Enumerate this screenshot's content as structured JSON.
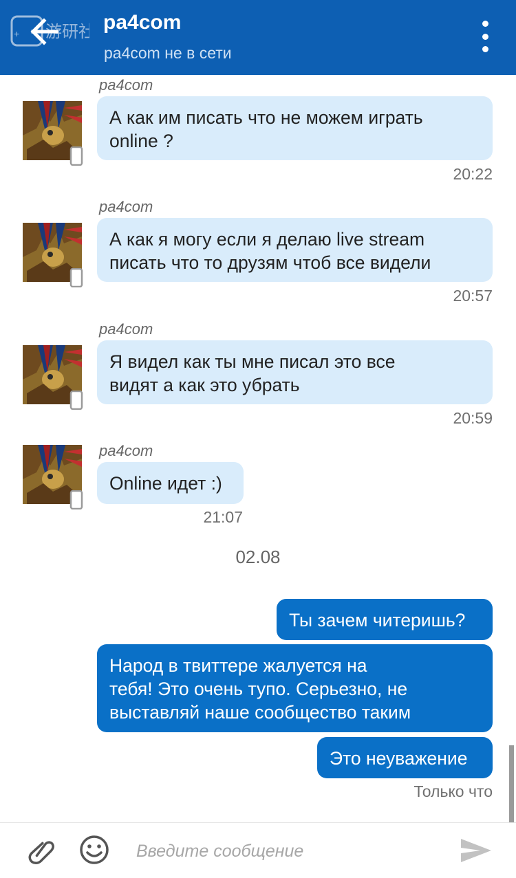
{
  "header": {
    "title": "pa4com",
    "status": "pa4com не в сети",
    "back_icon": "arrow-left-icon",
    "menu_icon": "more-vertical-icon",
    "watermark_text": "游研社",
    "color": "#0d5fb3"
  },
  "messages_in": [
    {
      "sender": "pa4com",
      "lines": [
        "А как им писать что не можем играть",
        "online ?"
      ],
      "time": "20:22"
    },
    {
      "sender": "pa4com",
      "lines": [
        "А как я могу если я делаю live stream",
        "писать что то друзям чтоб все видели"
      ],
      "time": "20:57"
    },
    {
      "sender": "pa4com",
      "lines": [
        "Я видел как ты мне писал это все",
        "видят а как это убрать"
      ],
      "time": "20:59"
    },
    {
      "sender": "pa4com",
      "lines": [
        "Online идет :)"
      ],
      "time": "21:07"
    }
  ],
  "date_separator": "02.08",
  "messages_out": [
    {
      "lines": [
        "Ты зачем читеришь?"
      ]
    },
    {
      "lines": [
        "Народ в твиттере жалуется на",
        "тебя! Это очень тупо. Серьезно,  не",
        "выставляй наше сообщество таким"
      ]
    },
    {
      "lines": [
        "Это неуважение"
      ]
    }
  ],
  "out_time": "Только что",
  "composer": {
    "placeholder": "Введите сообщение",
    "attach_icon": "paperclip-icon",
    "emoji_icon": "smiley-icon",
    "send_icon": "send-icon"
  },
  "colors": {
    "incoming_bubble": "#d9ecfb",
    "outgoing_bubble": "#0a70c7"
  }
}
